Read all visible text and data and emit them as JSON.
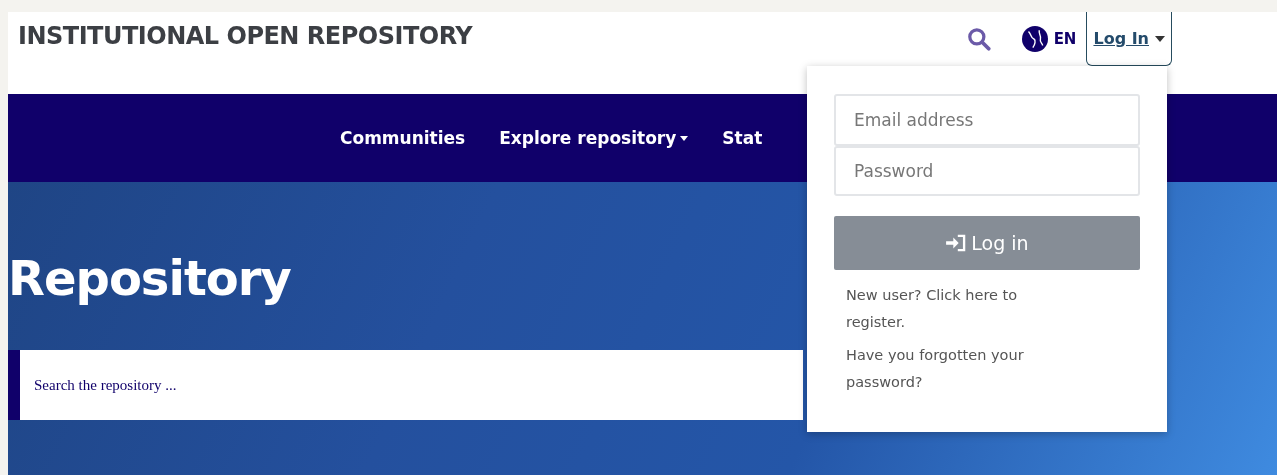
{
  "header": {
    "title": "INSTITUTIONAL OPEN REPOSITORY",
    "language": "EN",
    "login_toggle": {
      "label": "Log In",
      "expanded": true
    }
  },
  "nav": {
    "items": [
      {
        "label": "Communities",
        "dropdown": false
      },
      {
        "label": "Explore repository",
        "dropdown": true
      },
      {
        "label": "Stat",
        "dropdown": false
      }
    ]
  },
  "hero": {
    "title": "Repository",
    "search": {
      "placeholder": "Search the repository ..."
    }
  },
  "login_menu": {
    "email": {
      "placeholder": "Email address"
    },
    "password": {
      "placeholder": "Password"
    },
    "submit": "Log in",
    "links": [
      "New user? Click here to register.",
      "Have you forgotten your password?"
    ]
  }
}
